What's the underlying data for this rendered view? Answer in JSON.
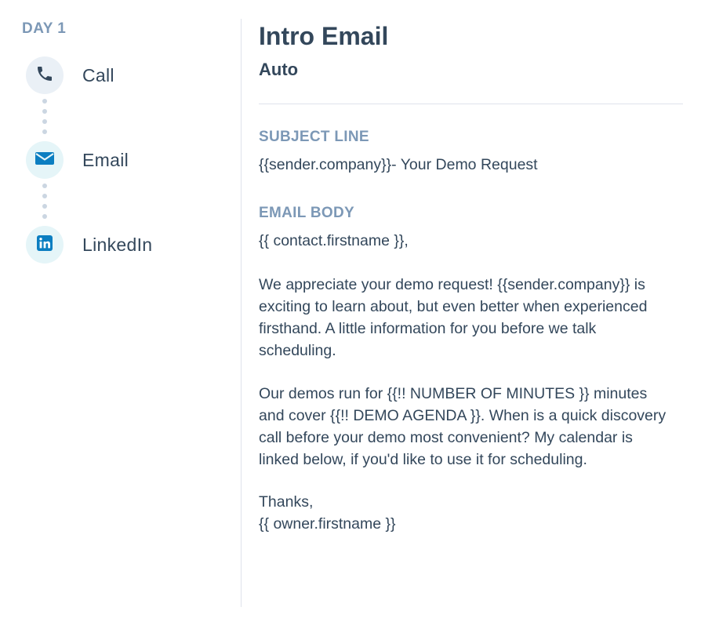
{
  "sidebar": {
    "day_label": "DAY 1",
    "steps": [
      {
        "label": "Call",
        "icon": "phone-icon"
      },
      {
        "label": "Email",
        "icon": "envelope-icon"
      },
      {
        "label": "LinkedIn",
        "icon": "linkedin-icon"
      }
    ]
  },
  "main": {
    "title": "Intro Email",
    "subtitle": "Auto",
    "subject_label": "SUBJECT LINE",
    "subject_value": "{{sender.company}}- Your Demo Request",
    "body_label": "EMAIL BODY",
    "body": {
      "greeting": "{{ contact.firstname }},",
      "paragraph1_lines": [
        "We appreciate your demo request! {{sender.company}} is",
        "exciting to learn about, but even better when experienced",
        "firsthand. A little information for you before we talk",
        "scheduling."
      ],
      "paragraph2_lines": [
        "Our demos run for {{!! NUMBER OF MINUTES }} minutes",
        "and cover {{!! DEMO AGENDA }}. When is a quick discovery",
        "call before your demo most convenient? My calendar is",
        "linked below, if you'd like to use it for scheduling."
      ],
      "signoff": "Thanks,",
      "signature": "{{ owner.firstname }}"
    }
  },
  "colors": {
    "text": "#33475b",
    "muted_label": "#7c98b6",
    "dot": "#cbd6e2",
    "icon_dark": "#33475b",
    "icon_blue": "#0b7ec1"
  }
}
